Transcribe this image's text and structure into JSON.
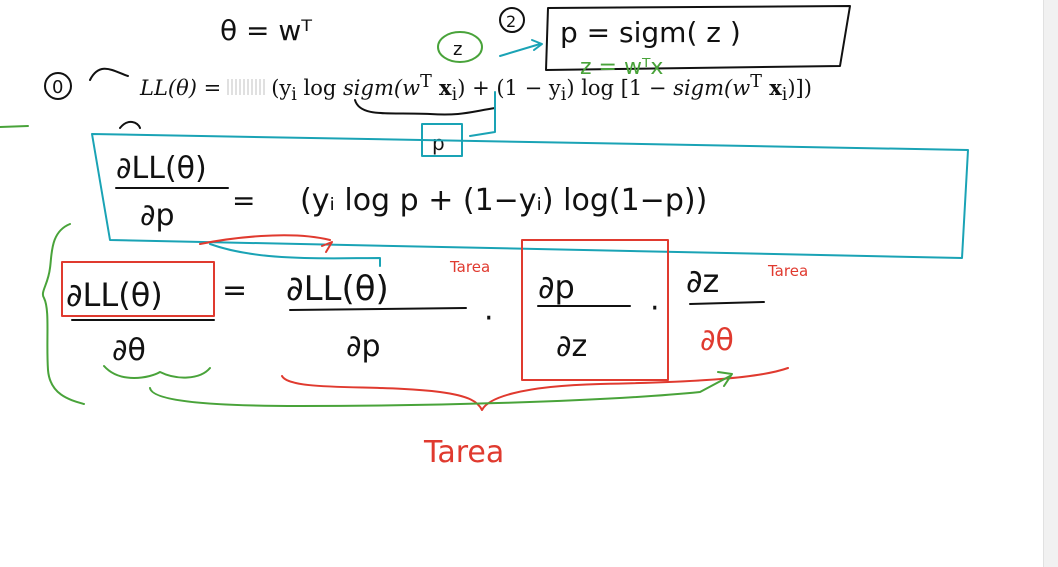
{
  "formula": {
    "lhs": "LL(θ) =",
    "part1": "(y",
    "part1_sub": "i",
    "part2": " log ",
    "part3": "sigm(w",
    "part3_sup": "T",
    "part4": " x",
    "part4_sub": "i",
    "part5": ") + (1 − y",
    "part5_sub": "i",
    "part6": ") log [1 − ",
    "part7": "sigm(w",
    "part7_sup": "T",
    "part8": " x",
    "part8_sub": "i",
    "part9": ")])"
  },
  "handwriting": {
    "theta_eq_wt": "θ = wᵀ",
    "circle_zero": "0",
    "circle_two": "2",
    "z_label": "z",
    "p_label": "p",
    "p_def": "p = sigm( z )",
    "z_def": "z = wᵀx",
    "box_num": "∂LL(θ)",
    "box_den": "∂p",
    "box_eq": "=",
    "box_rhs": "(yᵢ log p + (1−yᵢ) log(1−p))",
    "chain_lhs_num": "∂LL(θ)",
    "chain_lhs_den": "∂θ",
    "chain_eq": "=",
    "chain_f1_num": "∂LL(θ)",
    "chain_f1_den": "∂p",
    "chain_dot1": "·",
    "chain_f2_num": "∂p",
    "chain_f2_den": "∂z",
    "chain_dot2": "·",
    "chain_f3_num": "∂z",
    "chain_f3_den": "∂θ",
    "tarea_1": "Tarea",
    "tarea_2": "Tarea",
    "tarea_bottom": "Tarea"
  },
  "colors": {
    "black_ink": "#111111",
    "teal_ink": "#1aa3b5",
    "green_ink": "#49a33a",
    "red_ink": "#e03a2f"
  }
}
